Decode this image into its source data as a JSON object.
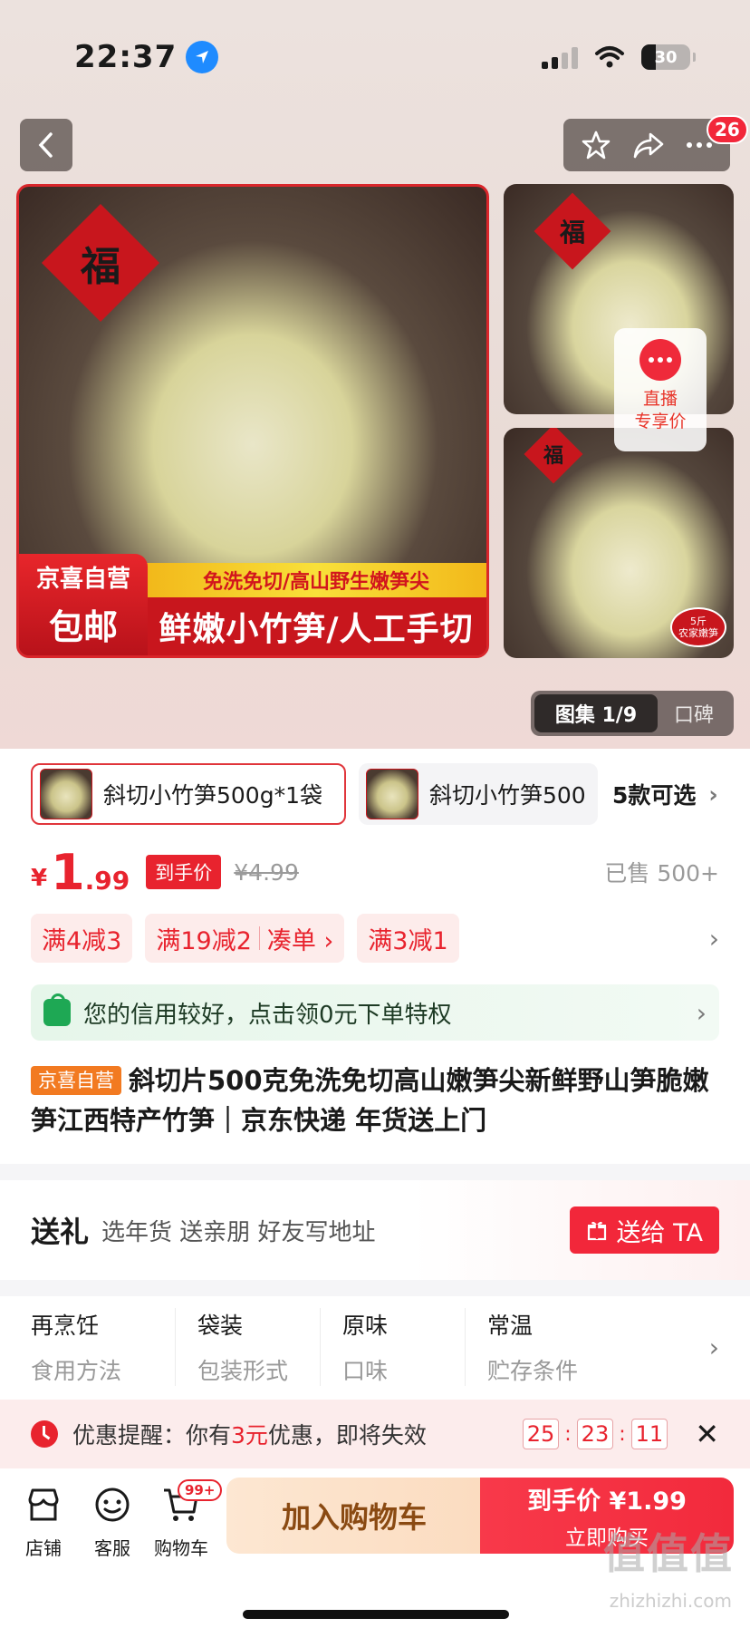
{
  "status": {
    "time": "22:37",
    "battery": "30"
  },
  "nav": {
    "cart_badge": "26"
  },
  "hero": {
    "main_badge_top": "京喜自营",
    "main_badge_bottom": "包邮",
    "yellow_banner": "免洗免切/高山野生嫩笋尖",
    "red_banner": "鲜嫩小竹笋/人工手切",
    "fu_char": "福",
    "live_label": "直播",
    "live_sub": "专享价",
    "stamp_top": "5斤",
    "stamp_bottom": "农家嫩笋",
    "gallery_active": "图集 1/9",
    "gallery_other": "口碑"
  },
  "variants": {
    "selected": "斜切小竹笋500g*1袋",
    "other": "斜切小竹笋500",
    "more": "5款可选"
  },
  "price": {
    "yen": "¥",
    "int": "1",
    "dec": ".99",
    "tag": "到手价",
    "original": "¥4.99",
    "sold": "已售 500+"
  },
  "coupons": [
    "满4减3",
    "满19减2",
    "凑单 ›",
    "满3减1"
  ],
  "credit_text": "您的信用较好，点击领0元下单特权",
  "title": {
    "tag": "京喜自营",
    "text": "斜切片500克免洗免切高山嫩笋尖新鲜野山笋脆嫩笋江西特产竹笋｜京东快递 年货送上门"
  },
  "gift": {
    "heading": "送礼",
    "sub": "选年货 送亲朋 好友写地址",
    "button": "送给 TA"
  },
  "attributes": [
    {
      "value": "再烹饪",
      "key": "食用方法"
    },
    {
      "value": "袋装",
      "key": "包装形式"
    },
    {
      "value": "原味",
      "key": "口味"
    },
    {
      "value": "常温",
      "key": "贮存条件"
    }
  ],
  "reminder": {
    "prefix": "优惠提醒：你有",
    "amount": "3元",
    "suffix": "优惠，即将失效",
    "h": "25",
    "m": "23",
    "s": "11"
  },
  "bottom": {
    "shop": "店铺",
    "service": "客服",
    "cart": "购物车",
    "cart_badge": "99+",
    "add_cart": "加入购物车",
    "buy_line1": "到手价 ¥1.99",
    "buy_line2": "立即购买"
  },
  "watermark": {
    "big": "值值值",
    "small": "zhizhizhi.com"
  },
  "colors": {
    "accent": "#e8232e",
    "brand_red": "#f2273a",
    "green": "#1ea854"
  }
}
